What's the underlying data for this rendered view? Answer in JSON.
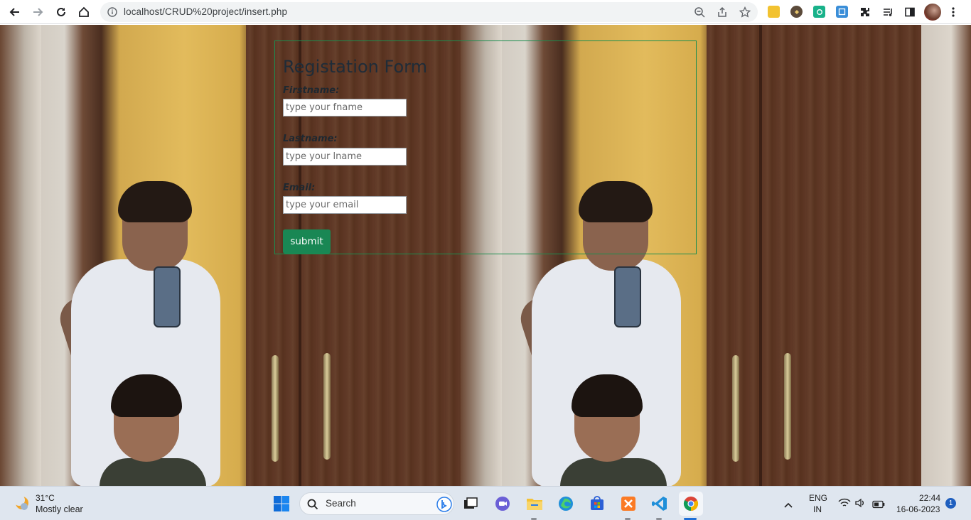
{
  "browser": {
    "url": "localhost/CRUD%20project/insert.php",
    "icons": [
      "back-icon",
      "forward-icon",
      "reload-icon",
      "home-icon",
      "info-icon",
      "zoom-icon",
      "share-icon",
      "star-icon",
      "extensions-icon",
      "media-icon",
      "sidepanel-icon",
      "menu-icon"
    ]
  },
  "form": {
    "title": "Registation Form",
    "fields": [
      {
        "label": "Firstname:",
        "placeholder": "type your fname"
      },
      {
        "label": "Lastname:",
        "placeholder": "type your lname"
      },
      {
        "label": "Email:",
        "placeholder": "type your email"
      }
    ],
    "submit_label": "submit",
    "border_color": "#198754",
    "button_color": "#198754"
  },
  "taskbar": {
    "weather_temp": "31°C",
    "weather_desc": "Mostly clear",
    "search_label": "Search",
    "lang_top": "ENG",
    "lang_bottom": "IN",
    "time": "22:44",
    "date": "16-06-2023",
    "notification_count": "1"
  }
}
